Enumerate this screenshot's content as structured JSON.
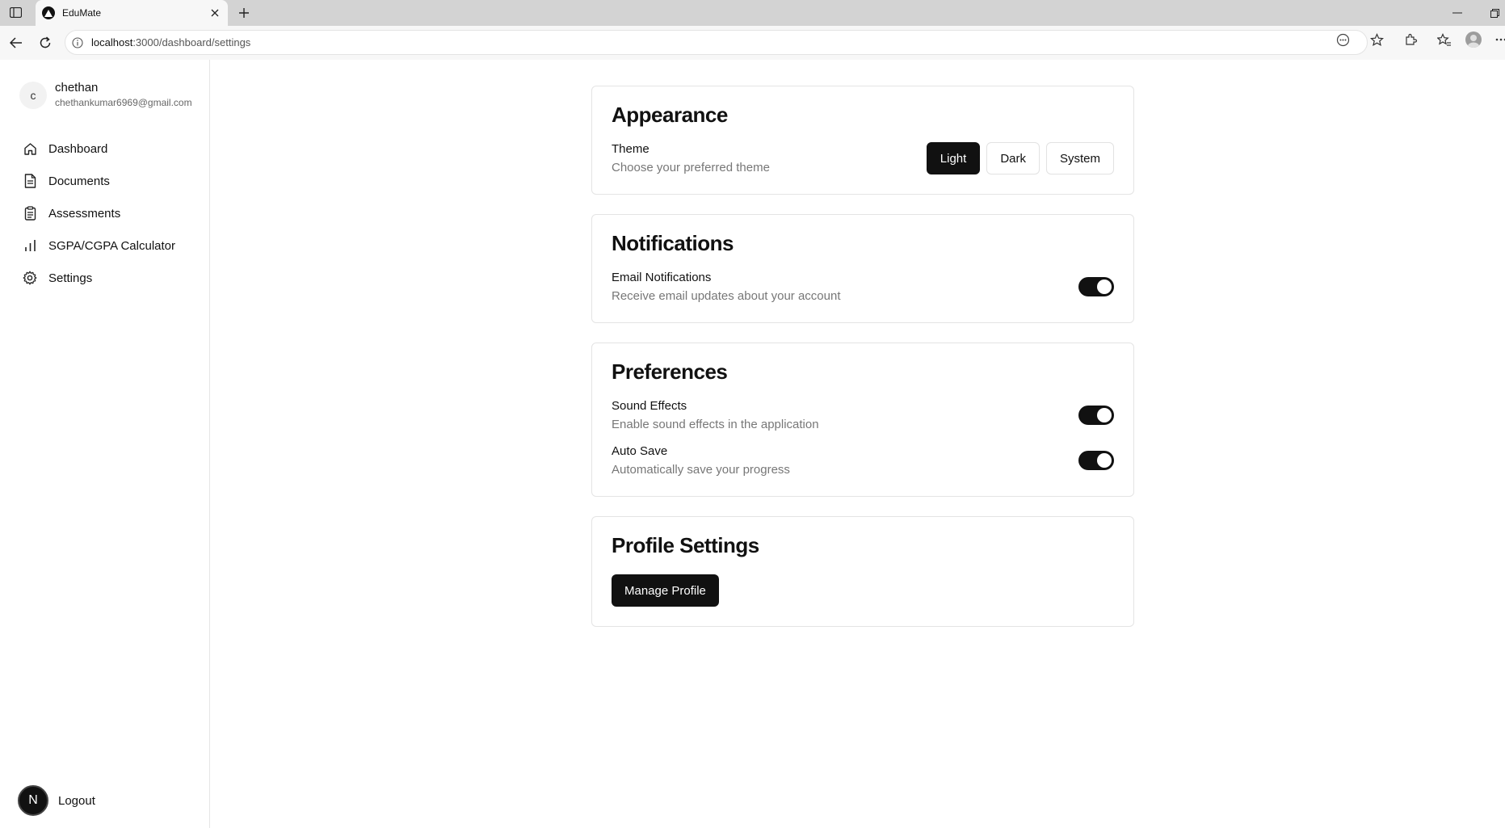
{
  "browser": {
    "tab_title": "EduMate",
    "url_host": "localhost",
    "url_rest": ":3000/dashboard/settings"
  },
  "user": {
    "initial": "c",
    "name": "chethan",
    "email": "chethankumar6969@gmail.com"
  },
  "sidebar": {
    "items": [
      {
        "label": "Dashboard",
        "icon": "home-icon"
      },
      {
        "label": "Documents",
        "icon": "document-icon"
      },
      {
        "label": "Assessments",
        "icon": "clipboard-icon"
      },
      {
        "label": "SGPA/CGPA Calculator",
        "icon": "bar-chart-icon"
      },
      {
        "label": "Settings",
        "icon": "gear-icon"
      }
    ],
    "logout_initial": "N",
    "logout_label": "Logout"
  },
  "appearance": {
    "title": "Appearance",
    "theme_label": "Theme",
    "theme_desc": "Choose your preferred theme",
    "options": [
      "Light",
      "Dark",
      "System"
    ],
    "selected": "Light"
  },
  "notifications": {
    "title": "Notifications",
    "email_label": "Email Notifications",
    "email_desc": "Receive email updates about your account",
    "email_on": true
  },
  "preferences": {
    "title": "Preferences",
    "sound_label": "Sound Effects",
    "sound_desc": "Enable sound effects in the application",
    "sound_on": true,
    "autosave_label": "Auto Save",
    "autosave_desc": "Automatically save your progress",
    "autosave_on": true
  },
  "profile": {
    "title": "Profile Settings",
    "button": "Manage Profile"
  },
  "colors": {
    "primary": "#111111",
    "border": "#e4e4e4",
    "muted_text": "#777777"
  }
}
